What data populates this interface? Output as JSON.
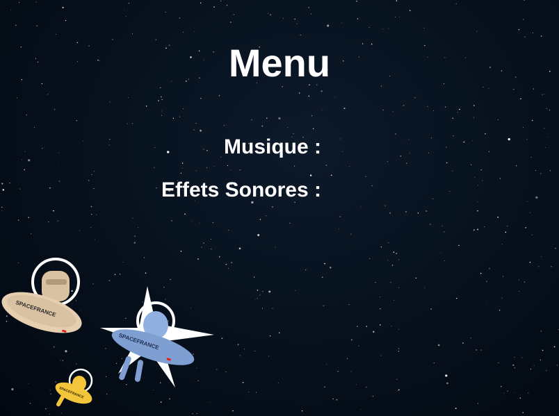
{
  "menu": {
    "title": "Menu",
    "options": [
      {
        "label": "Musique :"
      },
      {
        "label": "Effets Sonores :"
      }
    ]
  },
  "characters": [
    {
      "name": "beige-alien-ufo",
      "brand": "SPACEFRANCE"
    },
    {
      "name": "blue-alien-ufo",
      "brand": "SPACEFRANCE"
    },
    {
      "name": "yellow-alien-ufo",
      "brand": "SPACEFRANCE"
    }
  ],
  "colors": {
    "background": "#06101c",
    "text": "#ffffff",
    "beige_ship": "#e6cfb1",
    "blue_ship": "#7f9fd3",
    "yellow_ship": "#f3c53a",
    "brand_accent": "#e02020"
  }
}
